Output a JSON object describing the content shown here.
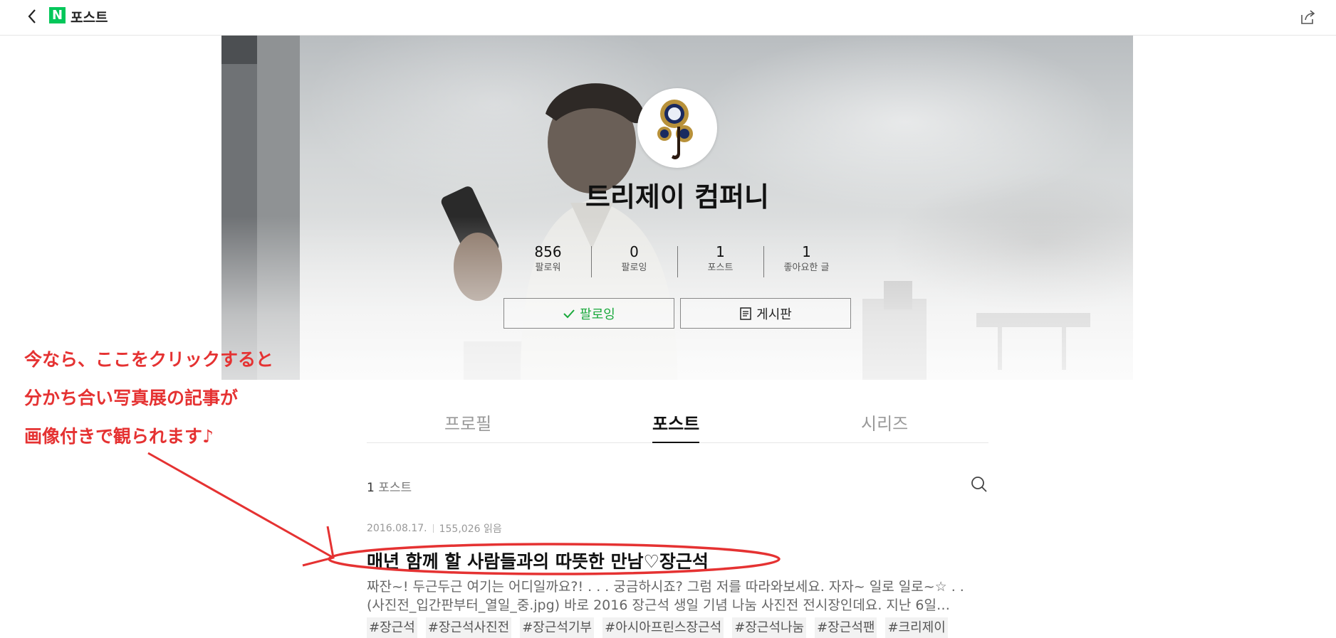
{
  "header": {
    "logo_letter": "N",
    "title": "포스트"
  },
  "channel": {
    "name": "트리제이 컴퍼니",
    "stats": [
      {
        "value": "856",
        "label": "팔로워"
      },
      {
        "value": "0",
        "label": "팔로잉"
      },
      {
        "value": "1",
        "label": "포스트"
      },
      {
        "value": "1",
        "label": "좋아요한 글"
      }
    ],
    "follow_label": "팔로잉",
    "board_label": "게시판"
  },
  "annotation": {
    "lines": [
      "今なら、ここをクリックすると",
      "分かち合い写真展の記事が",
      "画像付きで観られます♪"
    ],
    "color": "#e53232"
  },
  "tabs": [
    {
      "label": "프로필",
      "active": false
    },
    {
      "label": "포스트",
      "active": true
    },
    {
      "label": "시리즈",
      "active": false
    }
  ],
  "post_list": {
    "count": "1",
    "count_label": "포스트"
  },
  "post": {
    "date": "2016.08.17.",
    "reads": "155,026 읽음",
    "title": "매년 함께 할 사람들과의 따뜻한 만남♡장근석",
    "excerpt_lines": [
      "짜잔~! 두근두근 여기는 어디일까요?! . . . 궁금하시죠? 그럼 저를 따라와보세요. 자자~ 일로 일로~☆ . .",
      "(사진전_입간판부터_열일_중.jpg) 바로 2016 장근석 생일 기념 나눔 사진전 전시장인데요. 지난 6일…"
    ],
    "tags": [
      "#장근석",
      "#장근석사진전",
      "#장근석기부",
      "#아시아프린스장근석",
      "#장근석나눔",
      "#장근석팬",
      "#크리제이"
    ]
  },
  "colors": {
    "accent_green": "#03c75a",
    "follow_green": "#1aa93c",
    "annotation_red": "#e53232"
  }
}
